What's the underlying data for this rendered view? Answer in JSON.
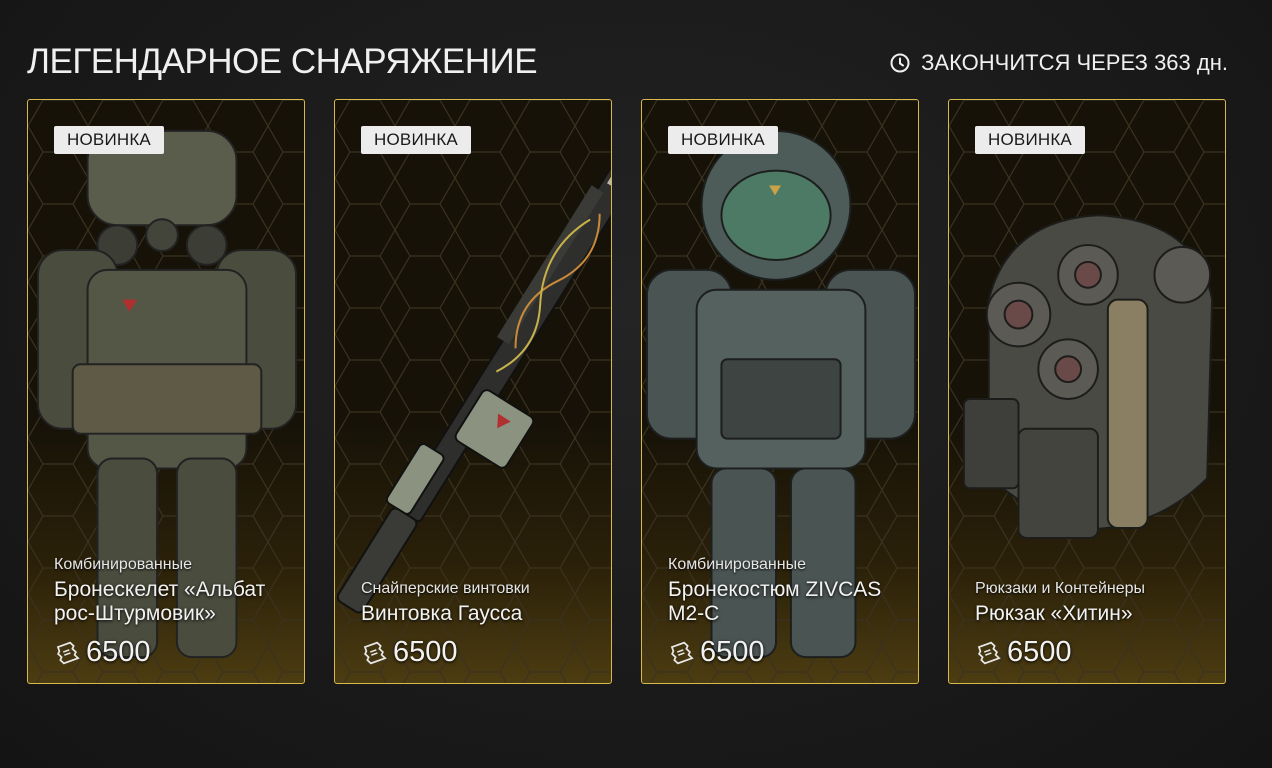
{
  "header": {
    "title": "ЛЕГЕНДАРНОЕ СНАРЯЖЕНИЕ",
    "timer_text": "ЗАКОНЧИТСЯ ЧЕРЕЗ 363 дн."
  },
  "colors": {
    "accent_border": "#d8b94e",
    "badge_bg": "#ececec",
    "background": "#1a1a1a"
  },
  "cards": [
    {
      "badge": "НОВИНКА",
      "category": "Комбинированные",
      "name": "Бронескелет «Альбат рос-Штурмовик»",
      "price": "6500",
      "icon": "currency-ticket-icon"
    },
    {
      "badge": "НОВИНКА",
      "category": "Снайперские винтовки",
      "name": "Винтовка Гаусса",
      "price": "6500",
      "icon": "currency-ticket-icon"
    },
    {
      "badge": "НОВИНКА",
      "category": "Комбинированные",
      "name": "Бронекостюм ZIVCAS M2-C",
      "price": "6500",
      "icon": "currency-ticket-icon"
    },
    {
      "badge": "НОВИНКА",
      "category": "Рюкзаки и Контейнеры",
      "name": "Рюкзак «Хитин»",
      "price": "6500",
      "icon": "currency-ticket-icon"
    }
  ]
}
